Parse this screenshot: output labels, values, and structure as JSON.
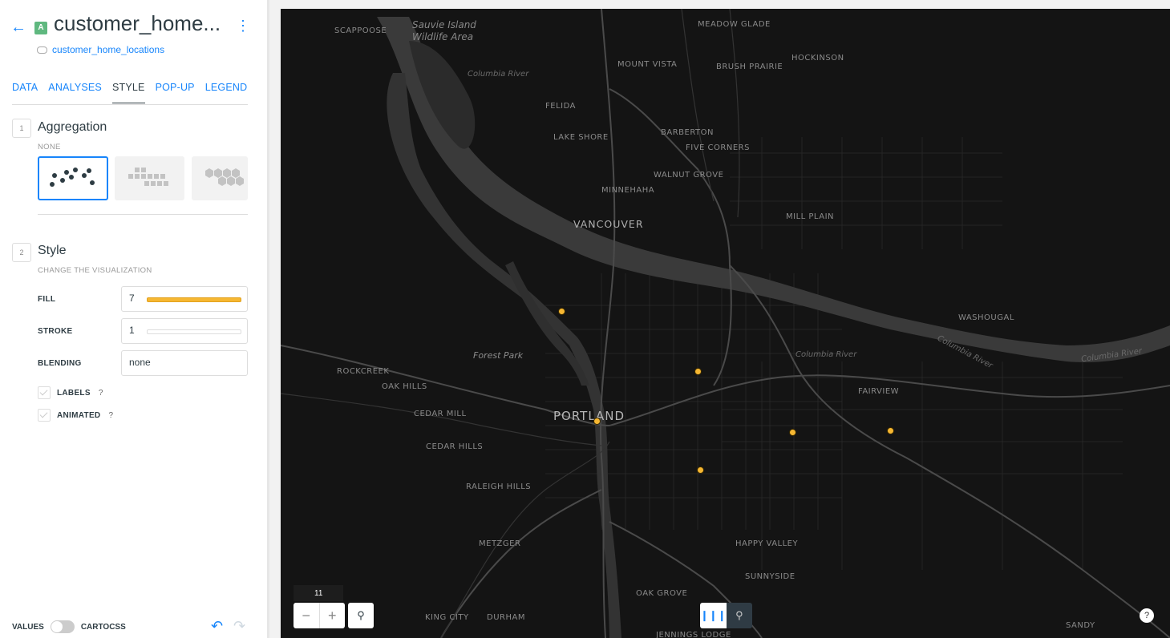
{
  "layer": {
    "badge": "A",
    "title": "customer_home...",
    "source": "customer_home_locations"
  },
  "tabs": [
    {
      "label": "DATA",
      "active": false
    },
    {
      "label": "ANALYSES",
      "active": false
    },
    {
      "label": "STYLE",
      "active": true
    },
    {
      "label": "POP-UP",
      "active": false
    },
    {
      "label": "LEGEND",
      "active": false
    }
  ],
  "aggregation": {
    "step": "1",
    "title": "Aggregation",
    "subtitle": "NONE",
    "options": [
      "points-icon",
      "squares-icon",
      "hexagons-icon"
    ],
    "selected": "points-icon"
  },
  "style": {
    "step": "2",
    "title": "Style",
    "subtitle": "CHANGE THE VISUALIZATION",
    "fill": {
      "label": "FILL",
      "value": "7",
      "color": "#f6b732"
    },
    "stroke": {
      "label": "STROKE",
      "value": "1"
    },
    "blending": {
      "label": "BLENDING",
      "value": "none"
    },
    "labels": {
      "label": "LABELS",
      "help": "?"
    },
    "animated": {
      "label": "ANIMATED",
      "help": "?"
    }
  },
  "footer": {
    "values": "VALUES",
    "cartocss": "CARTOCSS"
  },
  "map": {
    "zoom": "11",
    "help": "?",
    "point_color": "#f6b732",
    "labels": {
      "scappoose": "SCAPPOOSE",
      "sauvie": "Sauvie Island",
      "wildlife": "Wildlife Area",
      "meadow": "MEADOW GLADE",
      "mountvista": "MOUNT VISTA",
      "hockinson": "HOCKINSON",
      "brush": "BRUSH PRAIRIE",
      "columbia1": "Columbia River",
      "felida": "FELIDA",
      "barberton": "BARBERTON",
      "lakeshore": "LAKE SHORE",
      "fivecorners": "FIVE CORNERS",
      "walnut": "WALNUT GROVE",
      "minnehaha": "MINNEHAHA",
      "vancouver": "VANCOUVER",
      "millplain": "MILL PLAIN",
      "washougal": "WASHOUGAL",
      "forest": "Forest Park",
      "columbia2": "Columbia River",
      "columbia3": "Columbia River",
      "columbia4": "Columbia River",
      "rockcreek": "ROCKCREEK",
      "oakhills": "OAK HILLS",
      "fairview": "FAIRVIEW",
      "cedarmill": "CEDAR MILL",
      "portland": "PORTLAND",
      "cedarhills": "CEDAR HILLS",
      "raleigh": "RALEIGH HILLS",
      "metzger": "METZGER",
      "happy": "HAPPY VALLEY",
      "sunnyside": "SUNNYSIDE",
      "oakgrove": "OAK GROVE",
      "kingcity": "KING CITY",
      "durham": "DURHAM",
      "jennings": "JENNINGS LODGE",
      "sandy": "SANDY"
    }
  }
}
